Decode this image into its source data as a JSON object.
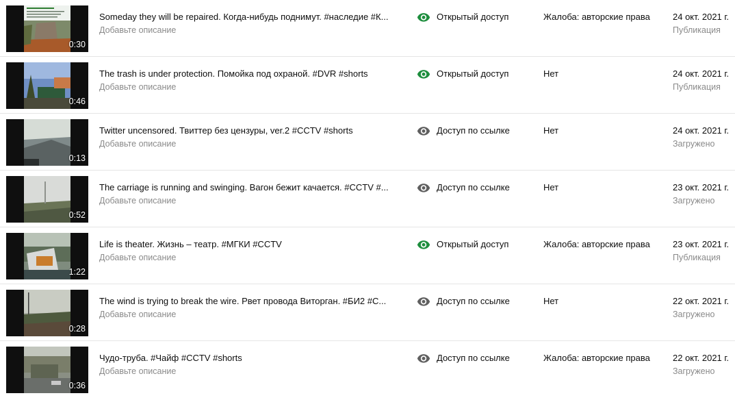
{
  "colors": {
    "public_eye": "#1e8e3e",
    "unlisted_eye": "#606060",
    "secondary_text": "#8a8a8a",
    "primary_text": "#0d0d0d"
  },
  "videos": [
    {
      "duration": "0:30",
      "title": "Someday they will be repaired. Когда-нибудь поднимут. #наследие #К...",
      "description": "Добавьте описание",
      "visibility": "Открытый доступ",
      "visibility_icon": "eye-public-icon",
      "restriction": "Жалоба: авторские права",
      "date": "24 окт. 2021 г.",
      "status": "Публикация"
    },
    {
      "duration": "0:46",
      "title": "The trash is under protection. Помойка под охраной. #DVR #shorts",
      "description": "Добавьте описание",
      "visibility": "Открытый доступ",
      "visibility_icon": "eye-public-icon",
      "restriction": "Нет",
      "date": "24 окт. 2021 г.",
      "status": "Публикация"
    },
    {
      "duration": "0:13",
      "title": "Twitter uncensored. Твиттер без цензуры, ver.2 #CCTV #shorts",
      "description": "Добавьте описание",
      "visibility": "Доступ по ссылке",
      "visibility_icon": "eye-unlisted-icon",
      "restriction": "Нет",
      "date": "24 окт. 2021 г.",
      "status": "Загружено"
    },
    {
      "duration": "0:52",
      "title": "The carriage is running and swinging. Вагон бежит качается. #CCTV #...",
      "description": "Добавьте описание",
      "visibility": "Доступ по ссылке",
      "visibility_icon": "eye-unlisted-icon",
      "restriction": "Нет",
      "date": "23 окт. 2021 г.",
      "status": "Загружено"
    },
    {
      "duration": "1:22",
      "title": "Life is theater. Жизнь – театр. #МГКИ #CCTV",
      "description": "Добавьте описание",
      "visibility": "Открытый доступ",
      "visibility_icon": "eye-public-icon",
      "restriction": "Жалоба: авторские права",
      "date": "23 окт. 2021 г.",
      "status": "Публикация"
    },
    {
      "duration": "0:28",
      "title": "The wind is trying to break the wire. Рвет провода Виторган. #БИ2 #C...",
      "description": "Добавьте описание",
      "visibility": "Доступ по ссылке",
      "visibility_icon": "eye-unlisted-icon",
      "restriction": "Нет",
      "date": "22 окт. 2021 г.",
      "status": "Загружено"
    },
    {
      "duration": "0:36",
      "title": "Чудо-труба. #Чайф #CCTV #shorts",
      "description": "Добавьте описание",
      "visibility": "Доступ по ссылке",
      "visibility_icon": "eye-unlisted-icon",
      "restriction": "Жалоба: авторские права",
      "date": "22 окт. 2021 г.",
      "status": "Загружено"
    }
  ]
}
